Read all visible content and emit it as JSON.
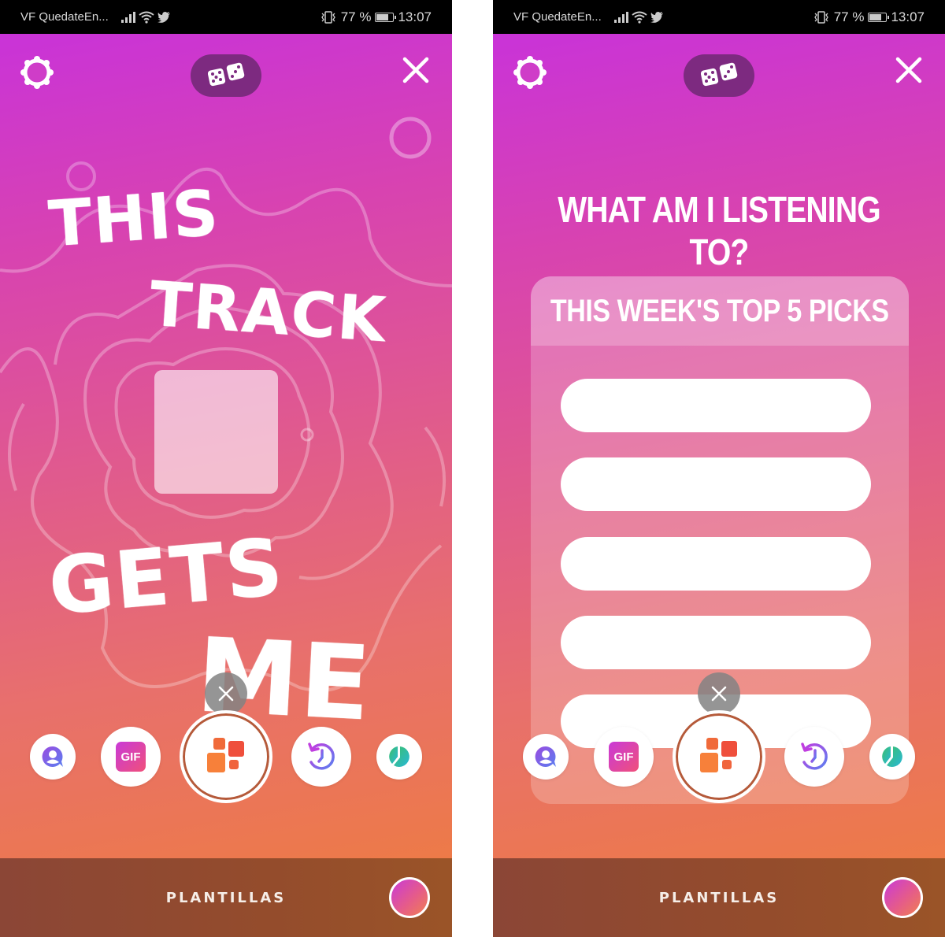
{
  "status_bar": {
    "carrier": "VF QuedateEn...",
    "battery_percent_label": "77 %",
    "battery_level": 0.77,
    "time": "13:07",
    "icons": [
      "signal-icon",
      "wifi-icon",
      "twitter-icon",
      "vibrate-icon"
    ]
  },
  "colors": {
    "gradient_top": "#c933d8",
    "gradient_bottom": "#ed7a48",
    "dice_pill": "#7d2a80",
    "bottom_bar": "#8b4636",
    "delete_button": "#828282"
  },
  "top_bar": {
    "settings_icon": "gear-icon",
    "randomize_icon": "dice-icon",
    "close_icon": "close-icon"
  },
  "screens": [
    {
      "template": "this-track-gets-me",
      "lines": [
        "THIS",
        "TRACK",
        "GETS",
        "ME"
      ],
      "album_art": "placeholder"
    },
    {
      "template": "top-5-picks",
      "title": "WHAT AM I LISTENING TO?",
      "card_title": "THIS WEEK'S TOP 5 PICKS",
      "picks": [
        "",
        "",
        "",
        "",
        ""
      ]
    }
  ],
  "tools": [
    {
      "name": "mention",
      "icon": "person-bubble-icon"
    },
    {
      "name": "gif",
      "label": "GIF",
      "icon": "gif-icon"
    },
    {
      "name": "templates",
      "icon": "templates-grid-icon",
      "selected": true
    },
    {
      "name": "memories",
      "icon": "history-clock-icon"
    },
    {
      "name": "poll",
      "icon": "pie-chart-icon"
    }
  ],
  "delete_icon": "close-icon",
  "bottom": {
    "mode_label": "PLANTILLAS",
    "color_picker": "gradient-swatch"
  }
}
